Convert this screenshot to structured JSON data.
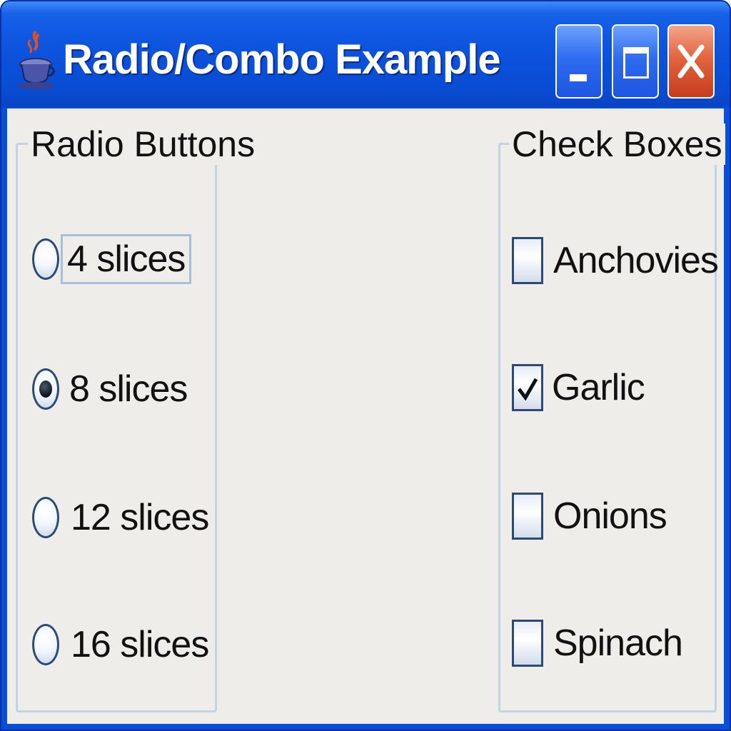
{
  "window": {
    "title": "Radio/Combo Example",
    "app_icon": "java-cup-icon",
    "title_color": "#ffffff",
    "titlebar_color": "#0a4fd8",
    "close_button_color": "#d9542c"
  },
  "radio_group": {
    "label": "Radio Buttons",
    "options": [
      {
        "label": "4 slices",
        "selected": false,
        "focused": true
      },
      {
        "label": "8 slices",
        "selected": true,
        "focused": false
      },
      {
        "label": "12 slices",
        "selected": false,
        "focused": false
      },
      {
        "label": "16 slices",
        "selected": false,
        "focused": false
      }
    ]
  },
  "check_group": {
    "label": "Check Boxes",
    "options": [
      {
        "label": "Anchovies",
        "checked": false
      },
      {
        "label": "Garlic",
        "checked": true
      },
      {
        "label": "Onions",
        "checked": false
      },
      {
        "label": "Spinach",
        "checked": false
      }
    ]
  }
}
